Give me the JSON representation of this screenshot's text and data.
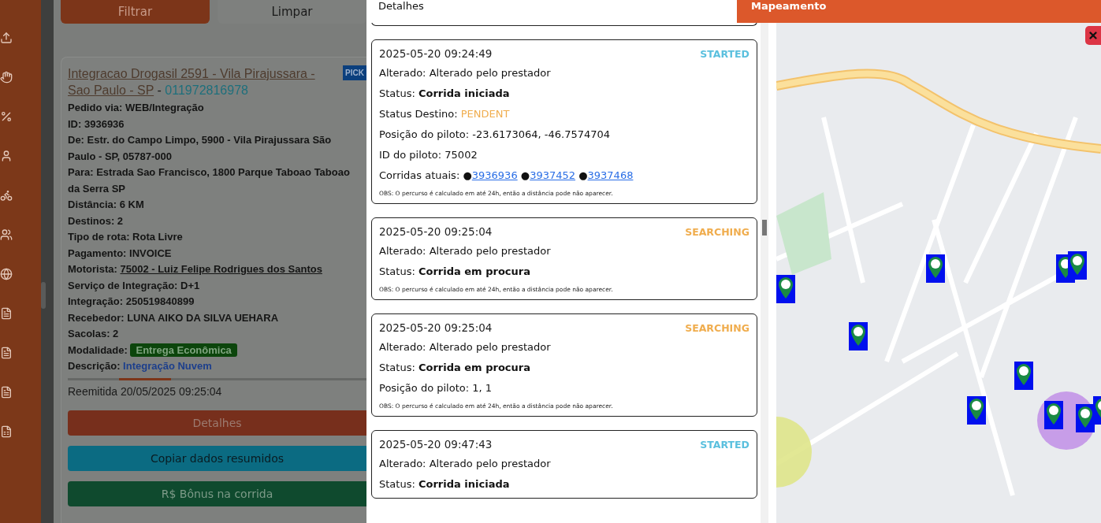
{
  "filters": {
    "buttons": [
      {
        "label": "Filtrar",
        "kind": "primary"
      },
      {
        "label": "Limpar",
        "kind": "plain"
      }
    ]
  },
  "order": {
    "title": "Integracao Drogasil 2591 - Vila Pirajussara - Sao Paulo - SP",
    "separator": "-",
    "phone": "011972816978",
    "badge": "PICK",
    "lines": [
      {
        "label": "Pedido via:",
        "value": "WEB/Integração",
        "kind": "text"
      },
      {
        "label": "ID:",
        "value": "3936936",
        "kind": "text"
      },
      {
        "label": "De:",
        "value": "Estr. do Campo Limpo, 5900 - Vila Pirajussara São Paulo - SP, 05787-000",
        "kind": "text"
      },
      {
        "label": "Para:",
        "value": "Estrada Sao Francisco, 1800 Parque Taboao Taboao da Serra SP",
        "kind": "text"
      },
      {
        "label": "Distância:",
        "value": "6 KM",
        "kind": "text"
      },
      {
        "label": "Destinos:",
        "value": "2",
        "kind": "text"
      },
      {
        "label": "Tipo de rota:",
        "value": "Rota Livre",
        "kind": "text"
      },
      {
        "label": "Pagamento:",
        "value": "INVOICE",
        "kind": "text"
      },
      {
        "label": "Motorista:",
        "value": "75002 - Luiz Felipe Rodrigues dos Santos",
        "kind": "link"
      },
      {
        "label": "Serviço de Integração:",
        "value": "D+1",
        "kind": "text"
      },
      {
        "label": "Integração:",
        "value": "250519840899",
        "kind": "text"
      },
      {
        "label": "Recebedor:",
        "value": "LUNA AIKO DA SILVA UEHARA",
        "kind": "text"
      },
      {
        "label": "Sacolas:",
        "value": "2",
        "kind": "text"
      },
      {
        "label": "Modalidade:",
        "value": "Entrega Econômica",
        "kind": "tag"
      },
      {
        "label": "Descrição:",
        "value": "Integração Nuvem",
        "kind": "accent"
      }
    ],
    "reissued": "Reemitida 20/05/2025 09:25:04",
    "actions": [
      {
        "label": "Detalhes",
        "kind": "orange"
      },
      {
        "label": "Copiar dados resumidos",
        "kind": "cyan"
      },
      {
        "label": "R$ Bônus na corrida",
        "kind": "green"
      }
    ]
  },
  "modal": {
    "details_title": "Detalhes",
    "map_title": "Mapeamento",
    "events": [
      {
        "time": "2025-05-20 09:24:49",
        "status": "STARTED",
        "color": "#5bc0de",
        "fields": [
          {
            "label": "Alterado:",
            "value": "Alterado pelo prestador",
            "kind": "text"
          },
          {
            "label": "Status:",
            "value": "Corrida iniciada",
            "kind": "bold"
          },
          {
            "label": "Status Destino:",
            "value": "PENDENT",
            "kind": "warn"
          },
          {
            "label": "Posição do piloto:",
            "value": "-23.6173064, -46.7574704",
            "kind": "text"
          },
          {
            "label": "ID do piloto:",
            "value": "75002",
            "kind": "text"
          },
          {
            "label": "Corridas atuais:",
            "bullet": "●",
            "links": [
              "3936936",
              "3937452",
              "3937468"
            ],
            "kind": "links"
          }
        ],
        "note": "OBS: O percurso é calculado em até 24h, então a distância pode não aparecer."
      },
      {
        "time": "2025-05-20 09:25:04",
        "status": "SEARCHING",
        "color": "#f0ad4e",
        "fields": [
          {
            "label": "Alterado:",
            "value": "Alterado pelo prestador",
            "kind": "text"
          },
          {
            "label": "Status:",
            "value": "Corrida em procura",
            "kind": "bold"
          }
        ],
        "note": "OBS: O percurso é calculado em até 24h, então a distância pode não aparecer."
      },
      {
        "time": "2025-05-20 09:25:04",
        "status": "SEARCHING",
        "color": "#f0ad4e",
        "fields": [
          {
            "label": "Alterado:",
            "value": "Alterado pelo prestador",
            "kind": "text"
          },
          {
            "label": "Status:",
            "value": "Corrida em procura",
            "kind": "bold"
          },
          {
            "label": "Posição do piloto:",
            "value": "1, 1",
            "kind": "text"
          }
        ],
        "note": "OBS: O percurso é calculado em até 24h, então a distância pode não aparecer."
      },
      {
        "time": "2025-05-20 09:47:43",
        "status": "STARTED",
        "color": "#5bc0de",
        "fields": [
          {
            "label": "Alterado:",
            "value": "Alterado pelo prestador",
            "kind": "text"
          },
          {
            "label": "Status:",
            "value": "Corrida iniciada",
            "kind": "bold"
          }
        ]
      }
    ]
  }
}
